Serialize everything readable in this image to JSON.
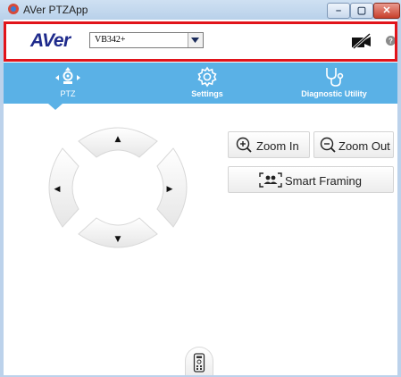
{
  "window": {
    "title": "AVer PTZApp",
    "controls": {
      "minimize": "–",
      "maximize": "▢",
      "close": "✕"
    }
  },
  "toolbar": {
    "logo_text": "AVer",
    "device_select": {
      "value": "VB342+"
    },
    "camera_off_icon": "camera-off-icon",
    "help_icon": "help-icon"
  },
  "nav": {
    "items": [
      {
        "label": "PTZ",
        "icon": "ptz-icon",
        "active": true
      },
      {
        "label": "Settings",
        "icon": "gear-icon",
        "active": false
      },
      {
        "label": "Diagnostic Utility",
        "icon": "stethoscope-icon",
        "active": false
      }
    ]
  },
  "ptz": {
    "dpad": {
      "up": "▲",
      "down": "▼",
      "left": "◀",
      "right": "▶"
    },
    "zoom_in_label": "Zoom In",
    "zoom_out_label": "Zoom Out",
    "smart_framing_label": "Smart Framing"
  },
  "colors": {
    "nav_bg": "#5ab1e6",
    "highlight": "#e1141b",
    "logo": "#1f2b8c"
  }
}
